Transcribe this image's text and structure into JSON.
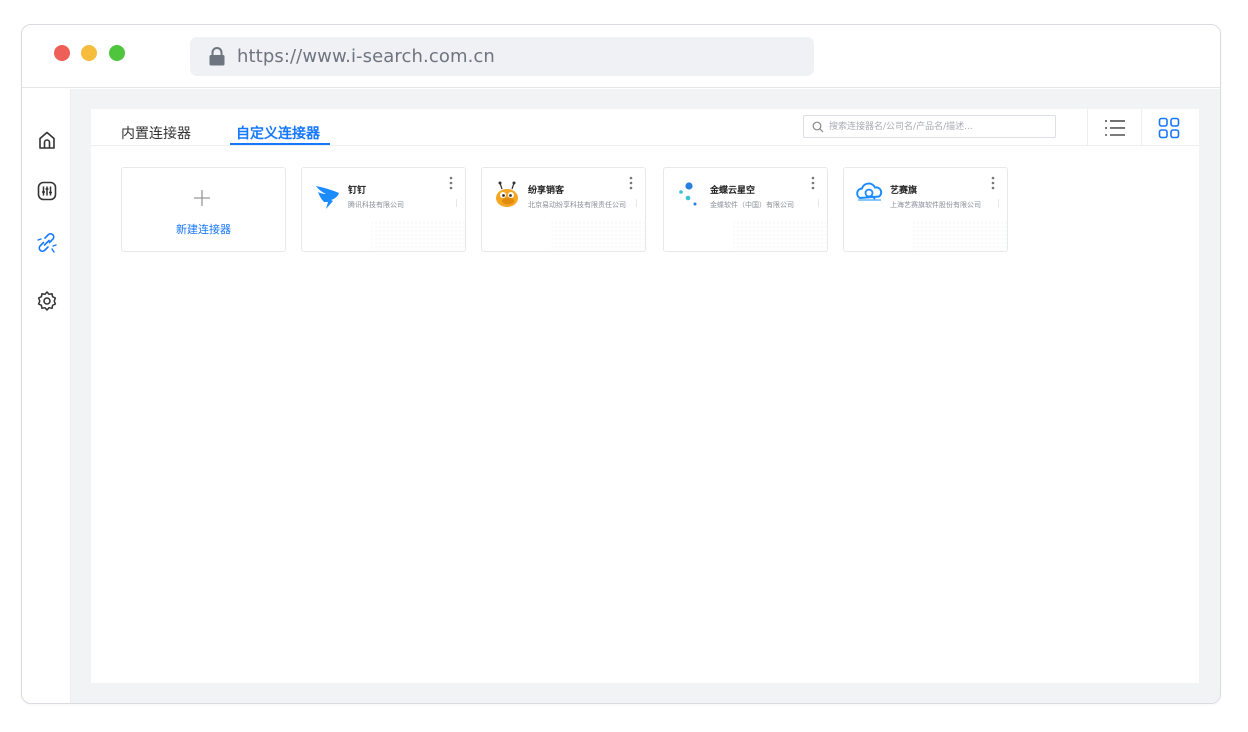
{
  "browser": {
    "url": "https://www.i-search.com.cn"
  },
  "sidebar": {
    "items": [
      {
        "name": "home"
      },
      {
        "name": "sliders"
      },
      {
        "name": "connector",
        "active": true
      },
      {
        "name": "settings"
      }
    ]
  },
  "tabs": [
    {
      "label": "内置连接器",
      "active": false
    },
    {
      "label": "自定义连接器",
      "active": true
    }
  ],
  "search": {
    "placeholder": "搜索连接器名/公司名/产品名/描述..."
  },
  "view": {
    "mode": "grid"
  },
  "new_connector": {
    "label": "新建连接器"
  },
  "connectors": [
    {
      "name": "钉钉",
      "company": "腾讯科技有限公司",
      "logo": "dingtalk-logo"
    },
    {
      "name": "纷享销客",
      "company": "北京易动纷享科技有限责任公司",
      "logo": "fxiaoke-logo"
    },
    {
      "name": "金蝶云星空",
      "company": "金蝶软件（中国）有限公司",
      "logo": "kingdee-logo"
    },
    {
      "name": "艺赛旗",
      "company": "上海艺赛旗软件股份有限公司",
      "logo": "isearch-logo"
    }
  ],
  "colors": {
    "accent": "#1677ff",
    "dot_red": "#ee5f57",
    "dot_yellow": "#f6bd3d",
    "dot_green": "#4fc43d"
  }
}
